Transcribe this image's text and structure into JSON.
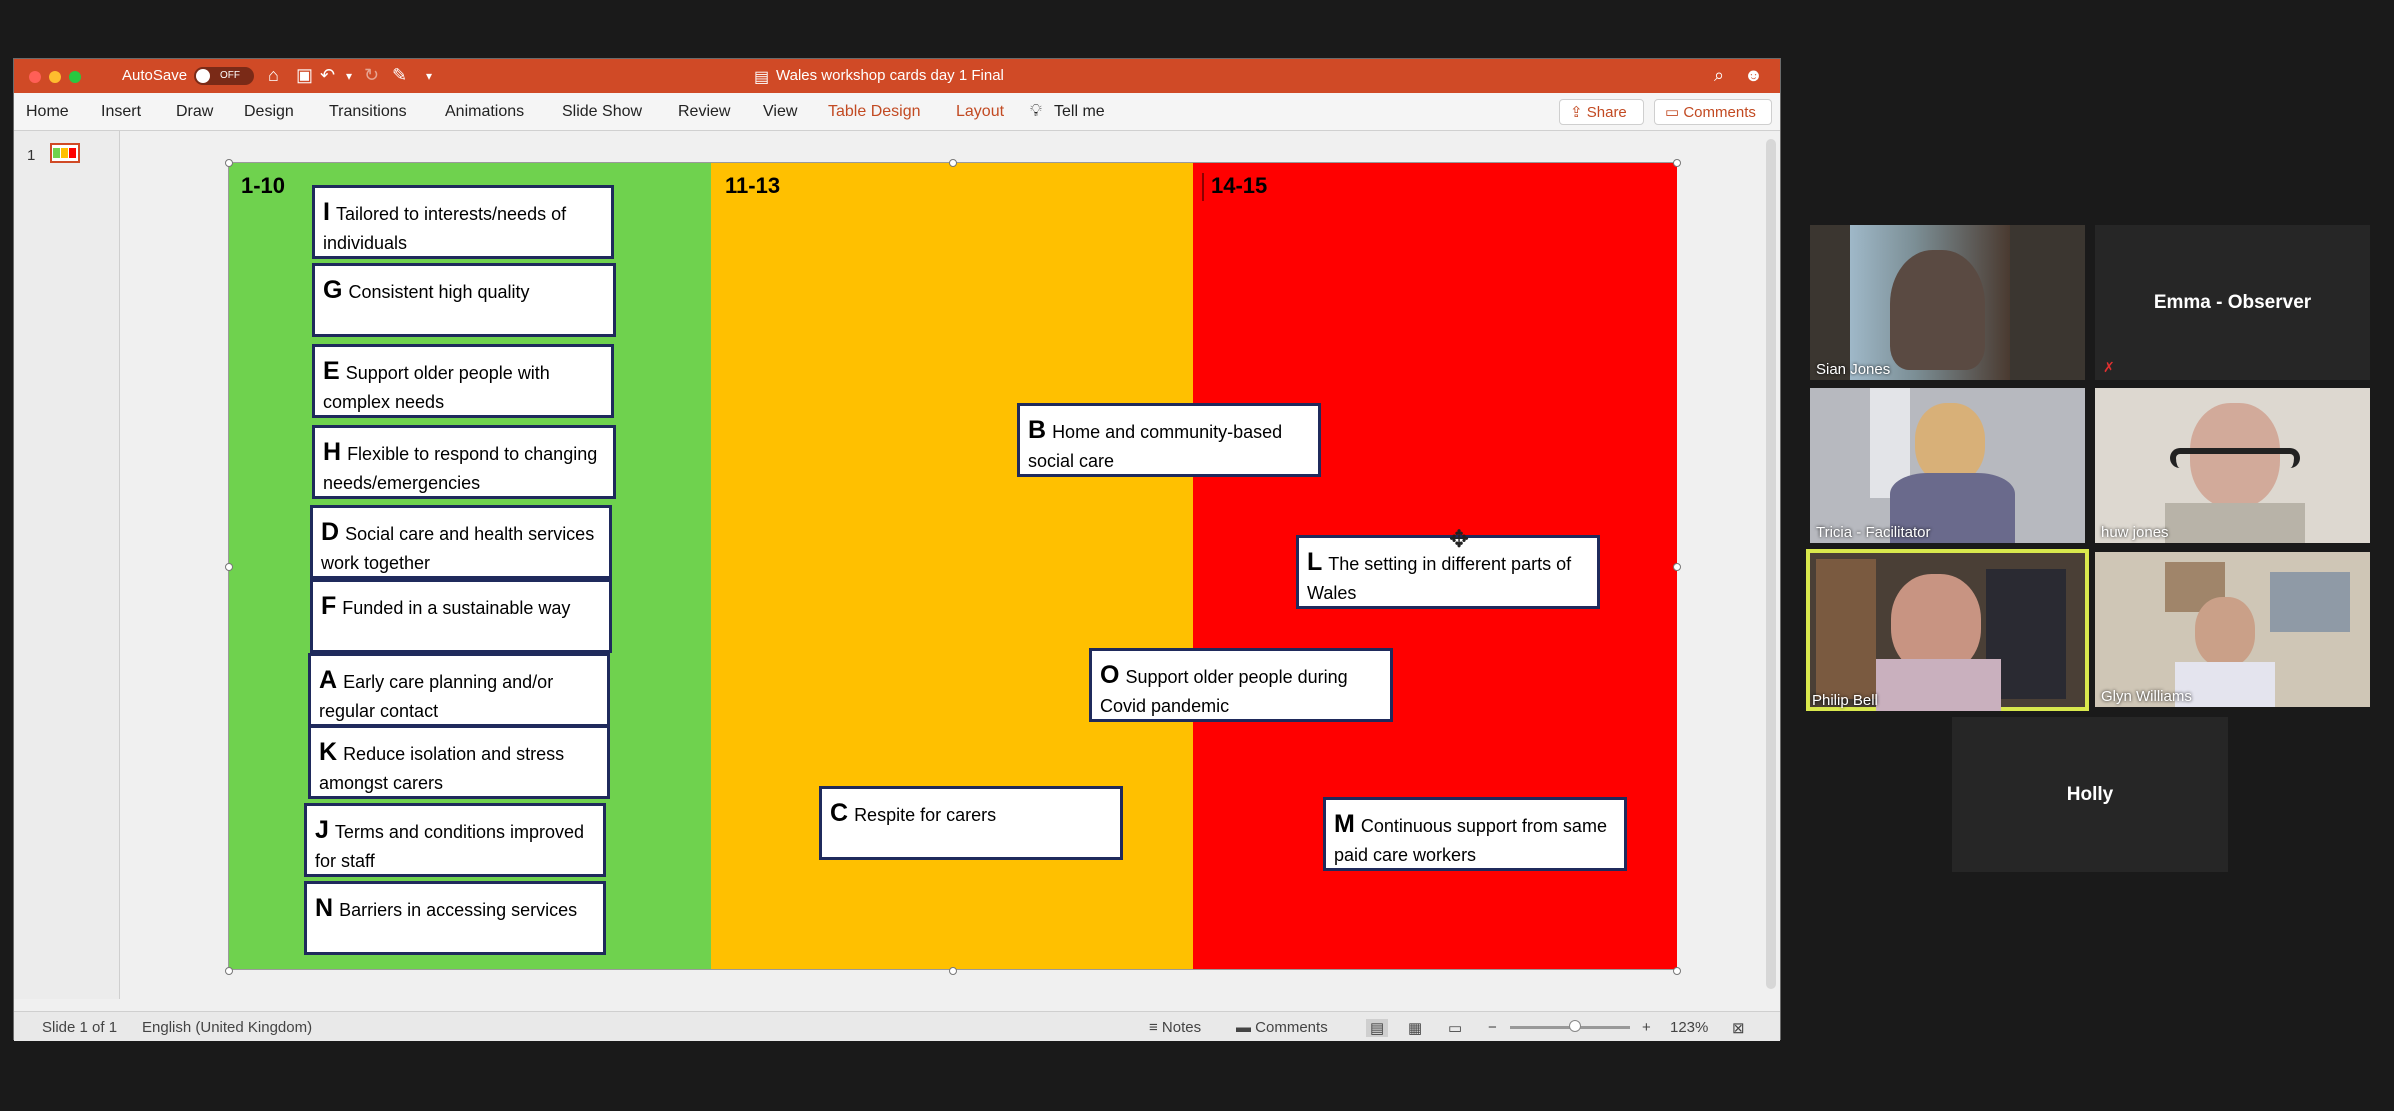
{
  "window": {
    "autosave_label": "AutoSave",
    "autosave_state": "OFF",
    "doc_title": "Wales workshop cards day 1 Final",
    "colors": {
      "titlebar": "#d04a26",
      "accent": "#c24a22"
    }
  },
  "ribbon": {
    "tabs": [
      "Home",
      "Insert",
      "Draw",
      "Design",
      "Transitions",
      "Animations",
      "Slide Show",
      "Review",
      "View",
      "Table Design",
      "Layout"
    ],
    "tell_me": "Tell me",
    "share": "Share",
    "comments": "Comments"
  },
  "thumbnails": {
    "number": "1"
  },
  "slide": {
    "columns": [
      {
        "header": "1-10",
        "color": "#6fd24e"
      },
      {
        "header": "11-13",
        "color": "#ffc000"
      },
      {
        "header": "14-15",
        "color": "#ff0000"
      }
    ],
    "cards": [
      {
        "letter": "I",
        "text": "Tailored to interests/needs of individuals"
      },
      {
        "letter": "G",
        "text": "Consistent high quality"
      },
      {
        "letter": "E",
        "text": "Support older people with complex needs"
      },
      {
        "letter": "H",
        "text": "Flexible to respond to changing needs/emergencies"
      },
      {
        "letter": "D",
        "text": "Social care and health services work together"
      },
      {
        "letter": "F",
        "text": "Funded in a sustainable way"
      },
      {
        "letter": "A",
        "text": "Early care planning and/or regular contact"
      },
      {
        "letter": "K",
        "text": "Reduce isolation and stress amongst carers"
      },
      {
        "letter": "J",
        "text": "Terms and conditions improved for staff"
      },
      {
        "letter": "N",
        "text": "Barriers in accessing services"
      },
      {
        "letter": "B",
        "text": "Home and community-based social care"
      },
      {
        "letter": "C",
        "text": "Respite for carers"
      },
      {
        "letter": "O",
        "text": "Support older people during Covid pandemic"
      },
      {
        "letter": "L",
        "text": "The setting in different parts of Wales"
      },
      {
        "letter": "M",
        "text": "Continuous support from same paid care workers"
      }
    ]
  },
  "status": {
    "slide": "Slide 1 of 1",
    "language": "English (United Kingdom)",
    "notes": "Notes",
    "comments": "Comments",
    "zoom": "123%"
  },
  "participants": [
    {
      "name": "Sian Jones"
    },
    {
      "name": "Emma - Observer",
      "muted": true
    },
    {
      "name": "Tricia - Facilitator"
    },
    {
      "name": "huw jones"
    },
    {
      "name": "Philip Bell",
      "active_speaker": true
    },
    {
      "name": "Glyn Williams"
    },
    {
      "name": "Holly"
    }
  ]
}
